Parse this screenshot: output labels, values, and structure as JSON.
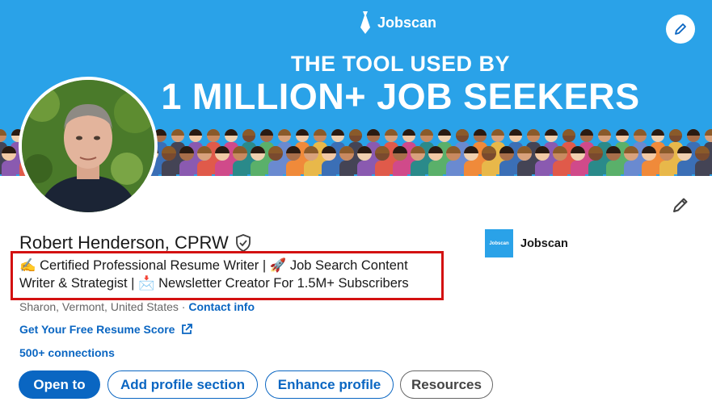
{
  "banner": {
    "brand": "Jobscan",
    "line1": "THE TOOL USED BY",
    "line2": "1 MILLION+ JOB SEEKERS",
    "colors": {
      "background": "#2aa2e8",
      "text": "#ffffff"
    },
    "edit_icon": "pencil-icon"
  },
  "profile": {
    "name": "Robert Henderson, CPRW",
    "verified_icon": "verified-shield-icon",
    "headline": "✍️ Certified Professional Resume Writer | 🚀 Job Search Content Writer & Strategist | 📩 Newsletter Creator For 1.5M+ Subscribers",
    "location": "Sharon, Vermont, United States",
    "location_separator": " · ",
    "contact_info": "Contact info",
    "website_link": "Get Your Free Resume Score",
    "connections": "500+ connections",
    "edit_icon": "pencil-icon"
  },
  "company": {
    "logo_text": "Jobscan",
    "name": "Jobscan"
  },
  "actions": {
    "open_to": "Open to",
    "add_section": "Add profile section",
    "enhance": "Enhance profile",
    "resources": "Resources"
  },
  "colors": {
    "link": "#0a66c2",
    "highlight_border": "#d31111"
  }
}
